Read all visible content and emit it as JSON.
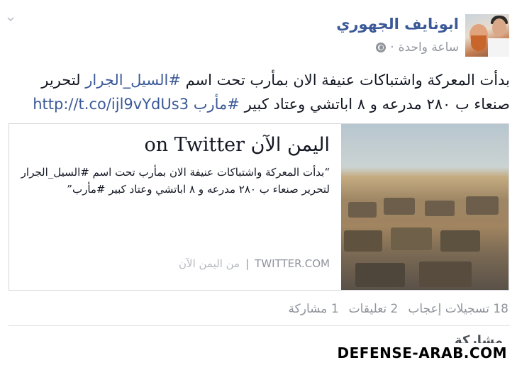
{
  "post": {
    "author": "ابونايف الجهوري",
    "time": "ساعة واحدة",
    "time_separator": "·",
    "text_before": "بدأت المعركة واشتباكات عنيفة الان بمأرب تحت اسم ",
    "hashtag1": "#السيل_الجرار",
    "text_middle": " لتحرير صنعاء ب ٢٨٠ مدرعه و ٨ اباتشي وعتاد كبير ",
    "hashtag2": "#مأرب",
    "link": "http://t.co/ijl9vYdUs3"
  },
  "card": {
    "title": "اليمن الآن on Twitter",
    "quote": "“بدأت المعركة واشتباكات عنيفة الان بمأرب تحت اسم #السيل_الجرار لتحرير صنعاء ب ٢٨٠ مدرعه و ٨ اباتشي وعتاد كبير #مأرب”",
    "source_domain": "TWITTER.COM",
    "source_separator": "|",
    "source_name": "من اليمن الآن"
  },
  "stats": {
    "likes": "18 تسجيلات إعجاب",
    "comments": "2 تعليقات",
    "shares": "1 مشاركة"
  },
  "actions": {
    "share": "مشاركة"
  },
  "watermark": "DEFENSE-ARAB.COM",
  "icons": {
    "options": "chevron-down-icon",
    "privacy": "globe-icon"
  },
  "colors": {
    "link": "#3b5998",
    "meta": "#90949c",
    "text": "#141823"
  }
}
